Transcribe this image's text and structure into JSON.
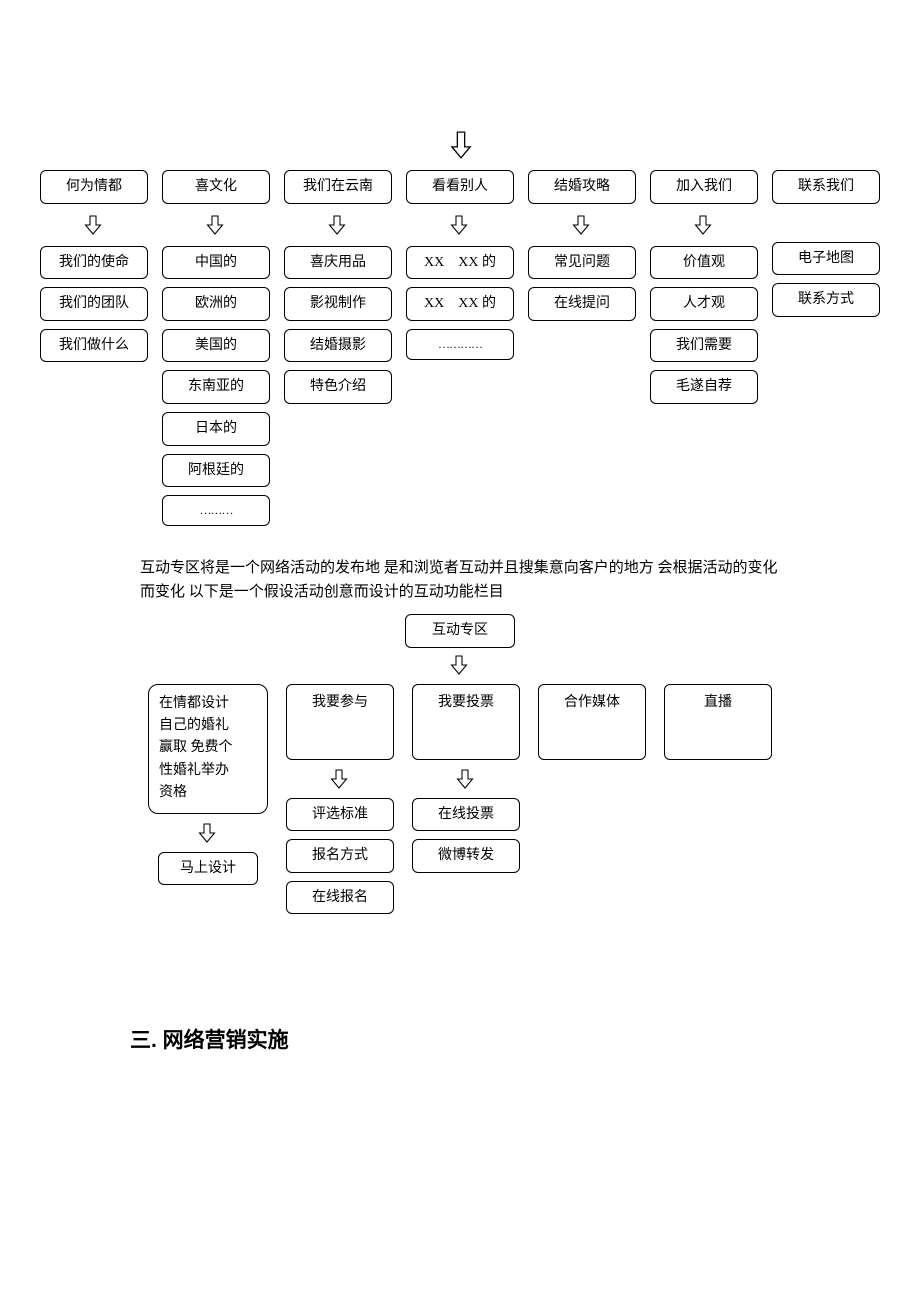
{
  "nav": {
    "columns": [
      {
        "header": "何为情都",
        "items": [
          "我们的使命",
          "我们的团队",
          "我们做什么"
        ]
      },
      {
        "header": "喜文化",
        "items": [
          "中国的",
          "欧洲的",
          "美国的",
          "东南亚的",
          "日本的",
          "阿根廷的",
          "………"
        ]
      },
      {
        "header": "我们在云南",
        "items": [
          "喜庆用品",
          "影视制作",
          "结婚摄影",
          "特色介绍"
        ]
      },
      {
        "header": "看看别人",
        "items": [
          "XX　XX 的",
          "XX　XX 的",
          "…………"
        ]
      },
      {
        "header": "结婚攻略",
        "items": [
          "常见问题",
          "在线提问"
        ]
      },
      {
        "header": "加入我们",
        "items": [
          "价值观",
          "人才观",
          "我们需要",
          "毛遂自荐"
        ]
      },
      {
        "header": "联系我们",
        "items": [
          "电子地图",
          "联系方式"
        ],
        "noArrow": true
      }
    ]
  },
  "paragraph": "互动专区将是一个网络活动的发布地 是和浏览者互动并且搜集意向客户的地方 会根据活动的变化而变化 以下是一个假设活动创意而设计的互动功能栏目",
  "interactive": {
    "root": "互动专区",
    "promo": {
      "lines": [
        "在情都设计",
        "自己的婚礼",
        "赢取 免费个",
        "性婚礼举办",
        "资格"
      ],
      "action": "马上设计"
    },
    "cols": [
      {
        "header": "我要参与",
        "items": [
          "评选标准",
          "报名方式",
          "在线报名"
        ]
      },
      {
        "header": "我要投票",
        "items": [
          "在线投票",
          "微博转发"
        ]
      },
      {
        "header": "合作媒体",
        "items": []
      },
      {
        "header": "直播",
        "items": []
      }
    ]
  },
  "heading": "三. 网络营销实施",
  "chart_data": {
    "type": "diagram",
    "note": "Two tree/org-chart style diagrams (site navigation sitemap and interactive-zone flow) in a Chinese document. Not a quantitative chart."
  }
}
